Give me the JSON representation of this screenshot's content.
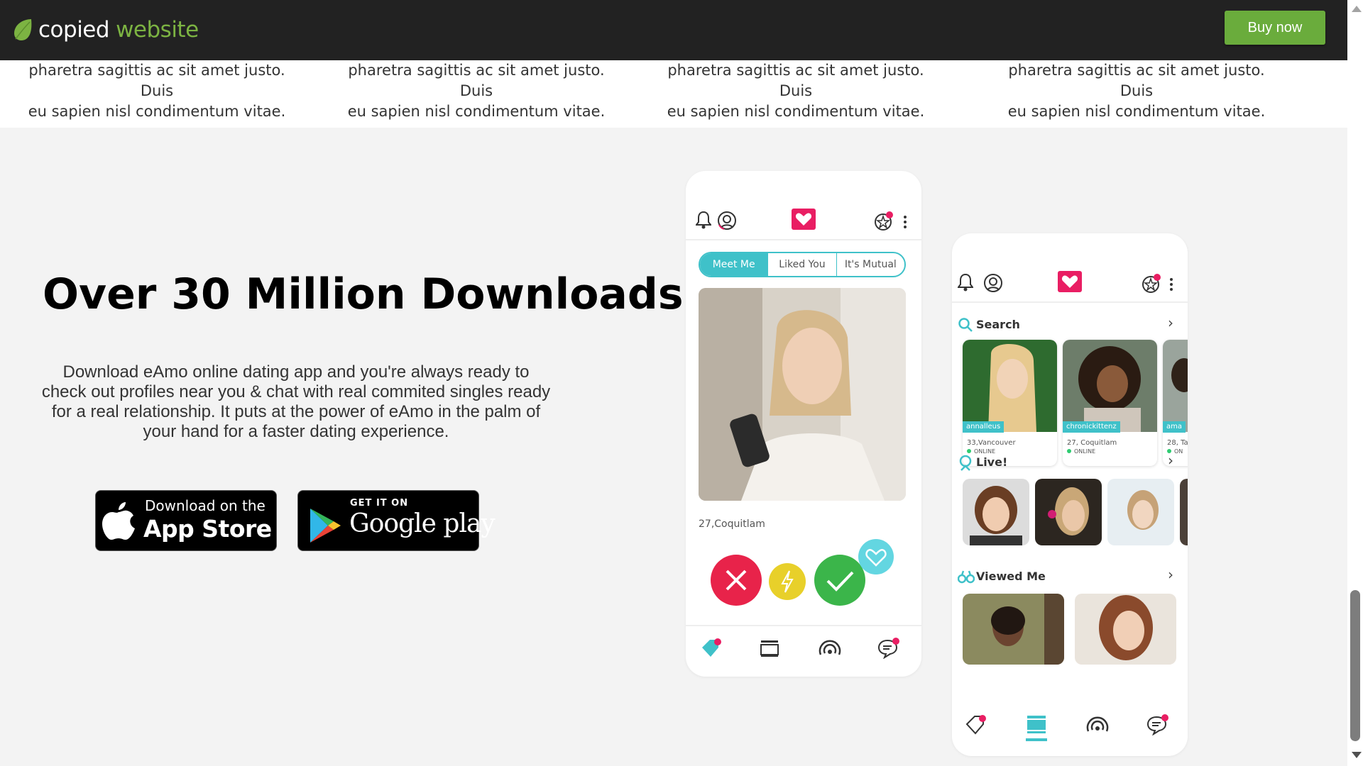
{
  "brand": {
    "word1": "copied",
    "word2": "website",
    "accent": "#7cb342"
  },
  "header": {
    "buy_label": "Buy now",
    "bg": "#222222",
    "button_color": "#6aac3c"
  },
  "features": [
    {
      "line1": "pharetra sagittis ac sit amet justo. Duis",
      "line2": "eu sapien nisl condimentum vitae."
    },
    {
      "line1": "pharetra sagittis ac sit amet justo. Duis",
      "line2": "eu sapien nisl condimentum vitae."
    },
    {
      "line1": "pharetra sagittis ac sit amet justo. Duis",
      "line2": "eu sapien nisl condimentum vitae."
    },
    {
      "line1": "pharetra sagittis ac sit amet justo. Duis",
      "line2": "eu sapien nisl condimentum vitae."
    }
  ],
  "hero": {
    "title": "Over 30 Million Downloads",
    "description": "Download eAmo online dating app and you're always ready to check out profiles near you & chat with real commited singles ready for a real relationship. It puts at the power of eAmo in the palm of your hand for a faster dating experience."
  },
  "stores": {
    "apple_small": "Download on the",
    "apple_big": "App Store",
    "google_small": "GET IT ON",
    "google_big": "Google play"
  },
  "phone1": {
    "tabs": [
      "Meet Me",
      "Liked You",
      "It's Mutual"
    ],
    "active_tab": "Meet Me",
    "caption": "27,Coquitlam",
    "accent": "#3fc1c9",
    "heart_color": "#e91e63"
  },
  "phone2": {
    "search_label": "Search",
    "live_label": "Live!",
    "viewed_label": "Viewed Me",
    "cards": [
      {
        "name": "annalleus",
        "loc": "33,Vancouver",
        "status": "ONLINE"
      },
      {
        "name": "chronickittenz",
        "loc": "27, Coquitlam",
        "status": "ONLINE"
      },
      {
        "name": "ama",
        "loc": "28, Ta",
        "status": "ON"
      }
    ],
    "chevron": "›"
  }
}
